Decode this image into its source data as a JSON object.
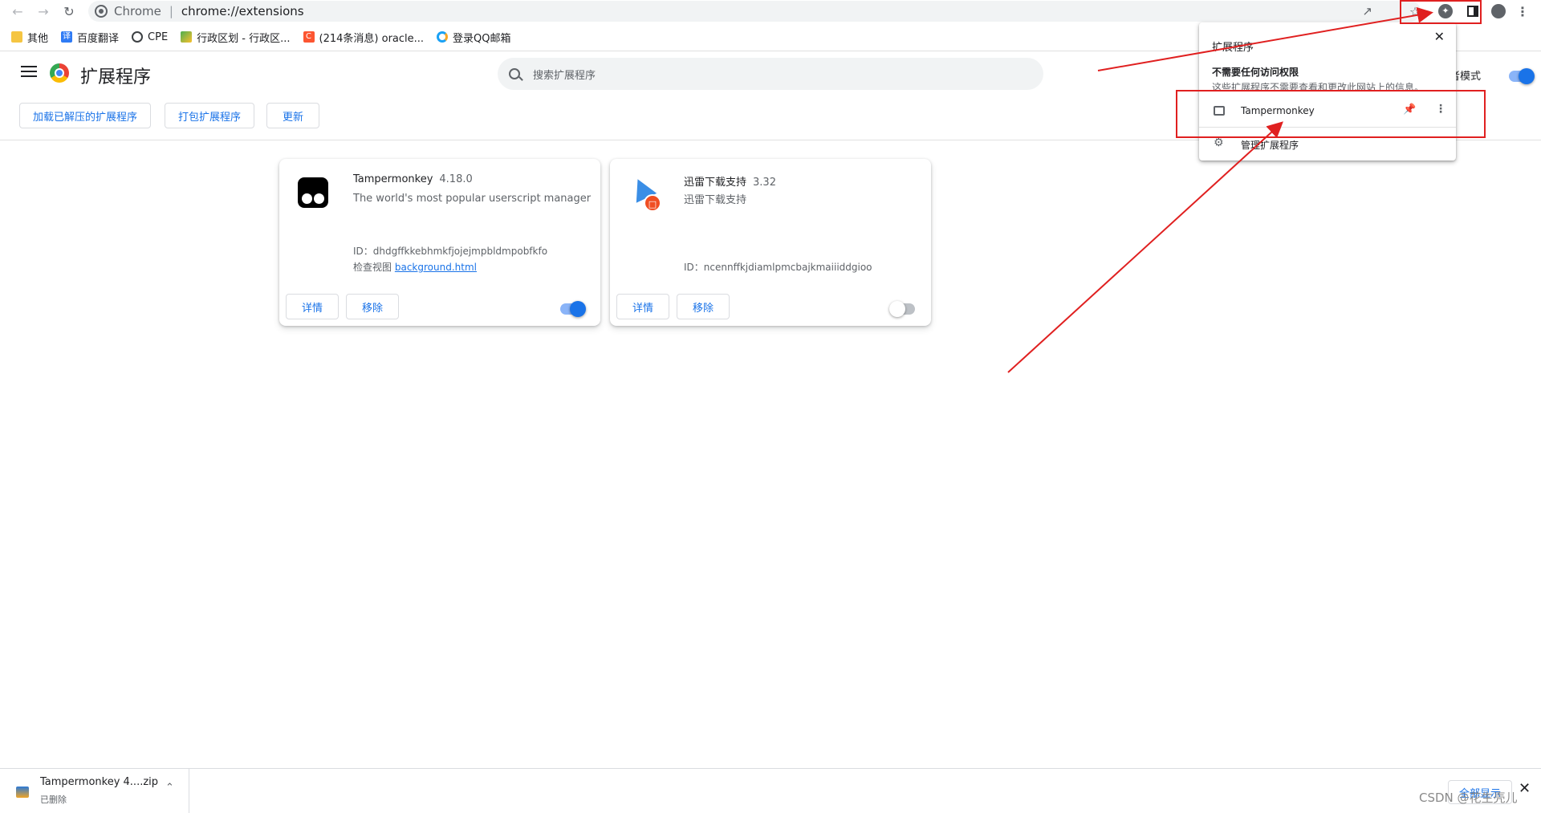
{
  "browser": {
    "omnibox_chip": "Chrome",
    "url": "chrome://extensions"
  },
  "bookmarks": [
    {
      "label": "其他",
      "icon": "folder-icon"
    },
    {
      "label": "百度翻译",
      "icon": "translate-icon"
    },
    {
      "label": "CPE",
      "icon": "globe-icon"
    },
    {
      "label": "行政区划 - 行政区...",
      "icon": "map-icon"
    },
    {
      "label": "(214条消息) oracle...",
      "icon": "csdn-icon"
    },
    {
      "label": "登录QQ邮箱",
      "icon": "qq-icon"
    }
  ],
  "header": {
    "title": "扩展程序",
    "search_placeholder": "搜索扩展程序",
    "dev_mode_label": "者模式",
    "dev_mode_on": true
  },
  "actions": {
    "load_unpacked": "加载已解压的扩展程序",
    "pack": "打包扩展程序",
    "update": "更新"
  },
  "extensions": [
    {
      "name": "Tampermonkey",
      "version": "4.18.0",
      "description": "The world's most popular userscript manager",
      "id_label": "ID：dhdgffkkebhmkfjojejmpbldmpobfkfo",
      "inspect_label": "检查视图",
      "inspect_link": "background.html",
      "details_label": "详情",
      "remove_label": "移除",
      "enabled": true
    },
    {
      "name": "迅雷下载支持",
      "version": "3.32",
      "description": "迅雷下载支持",
      "id_label": "ID：ncennffkjdiamlpmcbajkmaiiiddgioo",
      "details_label": "详情",
      "remove_label": "移除",
      "enabled": false
    }
  ],
  "popup": {
    "title": "扩展程序",
    "section": "不需要任何访问权限",
    "note": "这些扩展程序不需要查看和更改此网站上的信息。",
    "item_name": "Tampermonkey",
    "manage_label": "管理扩展程序"
  },
  "downloads": {
    "file_name": "Tampermonkey 4....zip",
    "status": "已删除",
    "show_all": "全部显示"
  },
  "watermark": "CSDN @花生壳儿",
  "colors": {
    "accent": "#1a73e8",
    "annotation_red": "#e02020"
  }
}
